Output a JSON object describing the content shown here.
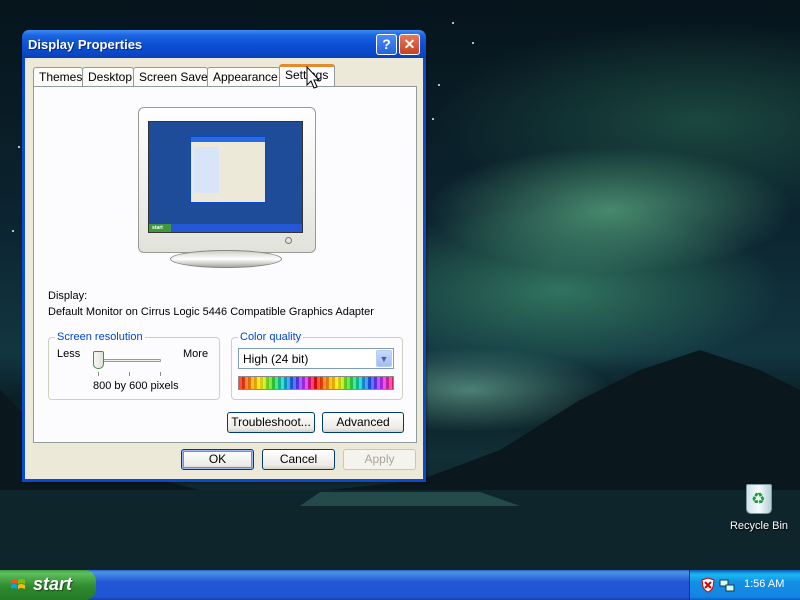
{
  "window": {
    "title": "Display Properties",
    "help_label": "?",
    "close_label": "✕"
  },
  "tabs": [
    {
      "label": "Themes"
    },
    {
      "label": "Desktop"
    },
    {
      "label": "Screen Saver"
    },
    {
      "label": "Appearance"
    },
    {
      "label": "Settings",
      "active": true
    }
  ],
  "monitor_preview": {
    "mini_start_label": "start"
  },
  "display": {
    "label": "Display:",
    "value": "Default Monitor on Cirrus Logic 5446 Compatible Graphics Adapter"
  },
  "resolution": {
    "group_label": "Screen resolution",
    "less_label": "Less",
    "more_label": "More",
    "value_text": "800 by 600 pixels",
    "slider_level": 0
  },
  "color_quality": {
    "group_label": "Color quality",
    "selected": "High (24 bit)",
    "dropdown_arrow": "▼"
  },
  "buttons": {
    "troubleshoot": "Troubleshoot...",
    "advanced": "Advanced",
    "ok": "OK",
    "cancel": "Cancel",
    "apply": "Apply"
  },
  "desktop_icons": [
    {
      "label": "Recycle Bin",
      "icon": "recycle-bin-icon"
    }
  ],
  "taskbar": {
    "start_label": "start",
    "clock": "1:56 AM",
    "tray_icons": [
      "security-alert-icon",
      "network-icon"
    ]
  },
  "colors": {
    "title_bar": "#0a4ad0",
    "active_tab_accent": "#e68b2c",
    "group_label": "#0046d5",
    "taskbar": "#2157d7",
    "start_button": "#3c9e3c"
  }
}
